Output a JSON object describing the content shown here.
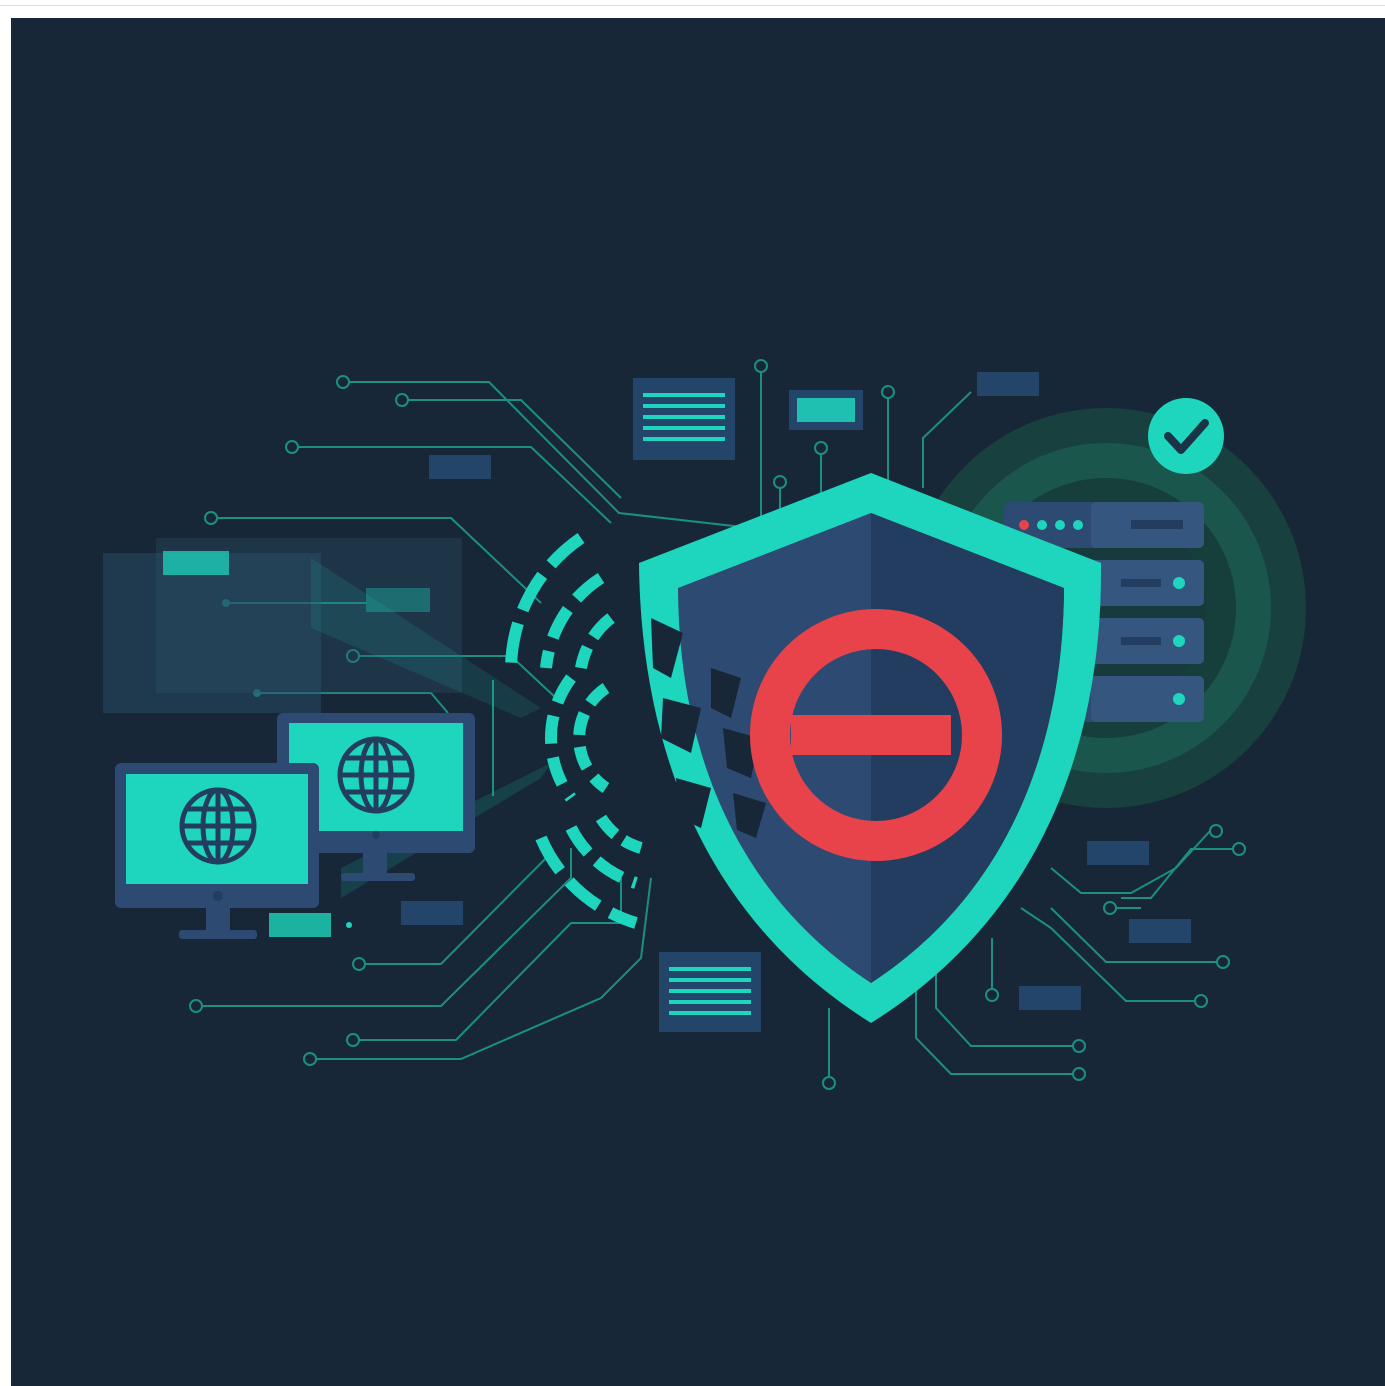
{
  "image": {
    "kind": "illustration",
    "text_content": []
  },
  "palette": {
    "background": "#172737",
    "teal": "#1ED6BD",
    "teal_dim": "#17a596",
    "circuit": "#1b8f84",
    "navy": "#2d4a72",
    "navy_dark": "#223d5f",
    "panel": "#24456a",
    "red": "#e8434a",
    "green_glow": "#1c5a4d"
  },
  "icons": {
    "shield": "shield-block-icon",
    "block": "no-entry-icon",
    "check": "checkmark-badge-icon",
    "server": "server-rack-icon",
    "monitor": "monitor-globe-icon",
    "signal": "signal-waves-icon"
  }
}
